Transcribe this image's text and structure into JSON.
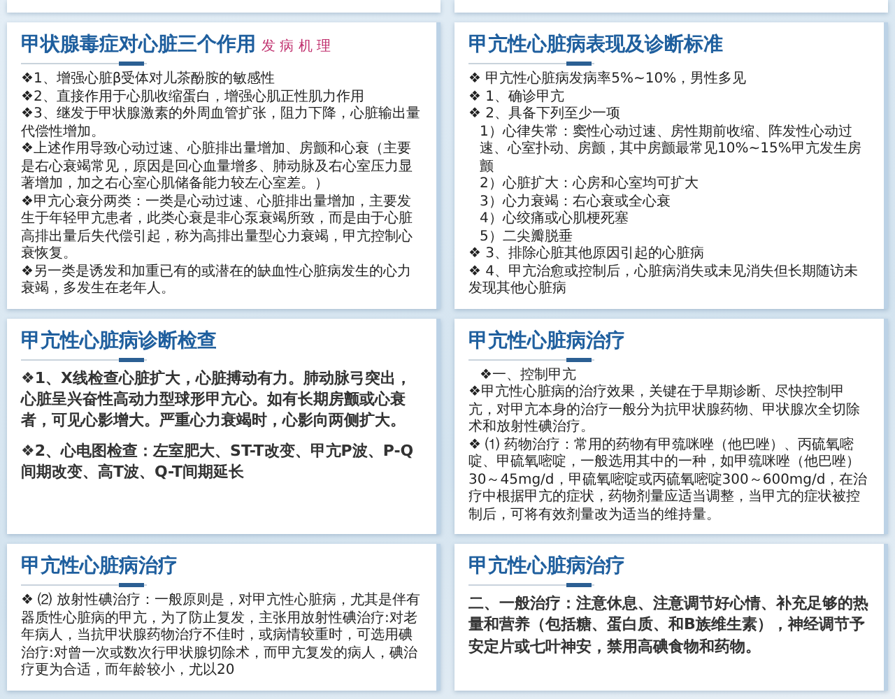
{
  "slides": [
    {
      "title": "甲状腺毒症对心脏三个作用",
      "subtitle": "发 病 机 理",
      "kind": "dense",
      "paragraphs": [
        {
          "kind": "point",
          "text": "❖1、增强心脏β受体对儿茶酚胺的敏感性"
        },
        {
          "kind": "point",
          "text": "❖2、直接作用于心肌收缩蛋白，增强心肌正性肌力作用"
        },
        {
          "kind": "point",
          "text": "❖3、继发于甲状腺激素的外周血管扩张，阻力下降，心脏输出量代偿性增加。"
        },
        {
          "kind": "point",
          "text": "❖上述作用导致心动过速、心脏排出量增加、房颤和心衰（主要是右心衰竭常见，原因是回心血量增多、肺动脉及右心室压力显著增加，加之右心室心肌储备能力较左心室差。）"
        },
        {
          "kind": "point",
          "text": "❖甲亢心衰分两类：一类是心动过速、心脏排出量增加，主要发生于年轻甲亢患者，此类心衰是非心泵衰竭所致，而是由于心脏高排出量后失代偿引起，称为高排出量型心力衰竭，甲亢控制心衰恢复。"
        },
        {
          "kind": "point",
          "text": "❖另一类是诱发和加重已有的或潜在的缺血性心脏病发生的心力衰竭，多发生在老年人。"
        }
      ]
    },
    {
      "title": "甲亢性心脏病表现及诊断标准",
      "kind": "dense",
      "paragraphs": [
        {
          "kind": "point",
          "text": "❖ 甲亢性心脏病发病率5%~10%，男性多见"
        },
        {
          "kind": "point",
          "text": "❖ 1、确诊甲亢"
        },
        {
          "kind": "point",
          "text": "❖ 2、具备下列至少一项"
        },
        {
          "kind": "sub",
          "text": "1）心律失常：窦性心动过速、房性期前收缩、阵发性心动过速、心室扑动、房颤，其中房颤最常见10%~15%甲亢发生房颤"
        },
        {
          "kind": "sub",
          "text": "2）心脏扩大：心房和心室均可扩大"
        },
        {
          "kind": "sub",
          "text": "3）心力衰竭：右心衰或全心衰"
        },
        {
          "kind": "sub",
          "text": "4）心绞痛或心肌梗死塞"
        },
        {
          "kind": "sub",
          "text": "5）二尖瓣脱垂"
        },
        {
          "kind": "point",
          "text": "❖ 3、排除心脏其他原因引起的心脏病"
        },
        {
          "kind": "point",
          "text": "❖ 4、甲亢治愈或控制后，心脏病消失或未见消失但长期随访未发现其他心脏病"
        }
      ]
    },
    {
      "title": "甲亢性心脏病诊断检查",
      "kind": "spaced",
      "paragraphs": [
        {
          "kind": "point",
          "text": "❖1、X线检查心脏扩大，心脏搏动有力。肺动脉弓突出，心脏呈兴奋性高动力型球形甲亢心。如有长期房颤或心衰者，可见心影增大。严重心力衰竭时，心影向两侧扩大。"
        },
        {
          "kind": "point",
          "text": "❖2、心电图检查：左室肥大、ST-T改变、甲亢P波、P-Q间期改变、高T波、Q-T间期延长"
        }
      ]
    },
    {
      "title": "甲亢性心脏病治疗",
      "kind": "dense",
      "paragraphs": [
        {
          "kind": "sub",
          "text": "❖一、控制甲亢"
        },
        {
          "kind": "point",
          "text": "❖甲亢性心脏病的治疗效果，关键在于早期诊断、尽快控制甲亢，对甲亢本身的治疗一般分为抗甲状腺药物、甲状腺次全切除术和放射性碘治疗。"
        },
        {
          "kind": "point",
          "text": "❖ ⑴ 药物治疗：常用的药物有甲巯咪唑（他巴唑）、丙硫氧嘧啶、甲硫氧嘧啶，一般选用其中的一种，如甲巯咪唑（他巴唑）30～45mg/d，甲硫氧嘧啶或丙硫氧嘧啶300～600mg/d，在治疗中根据甲亢的症状，药物剂量应适当调整，当甲亢的症状被控制后，可将有效剂量改为适当的维持量。"
        }
      ]
    },
    {
      "title": "甲亢性心脏病治疗",
      "kind": "dense",
      "paragraphs": [
        {
          "kind": "point",
          "text": "❖ ⑵ 放射性碘治疗：一般原则是，对甲亢性心脏病，尤其是伴有器质性心脏病的甲亢，为了防止复发，主张用放射性碘治疗:对老年病人，当抗甲状腺药物治疗不佳时，或病情较重时，可选用碘治疗:对曾一次或数次行甲状腺切除术，而甲亢复发的病人，碘治疗更为合适，而年龄较小，尤以20"
        }
      ]
    },
    {
      "title": "甲亢性心脏病治疗",
      "kind": "spaced",
      "paragraphs": [
        {
          "kind": "plain",
          "text": "二、一般治疗：注意休息、注意调节好心情、补充足够的热量和营养（包括糖、蛋白质、和B族维生素），神经调节予安定片或七叶神安，禁用高碘食物和药物。"
        }
      ]
    }
  ]
}
